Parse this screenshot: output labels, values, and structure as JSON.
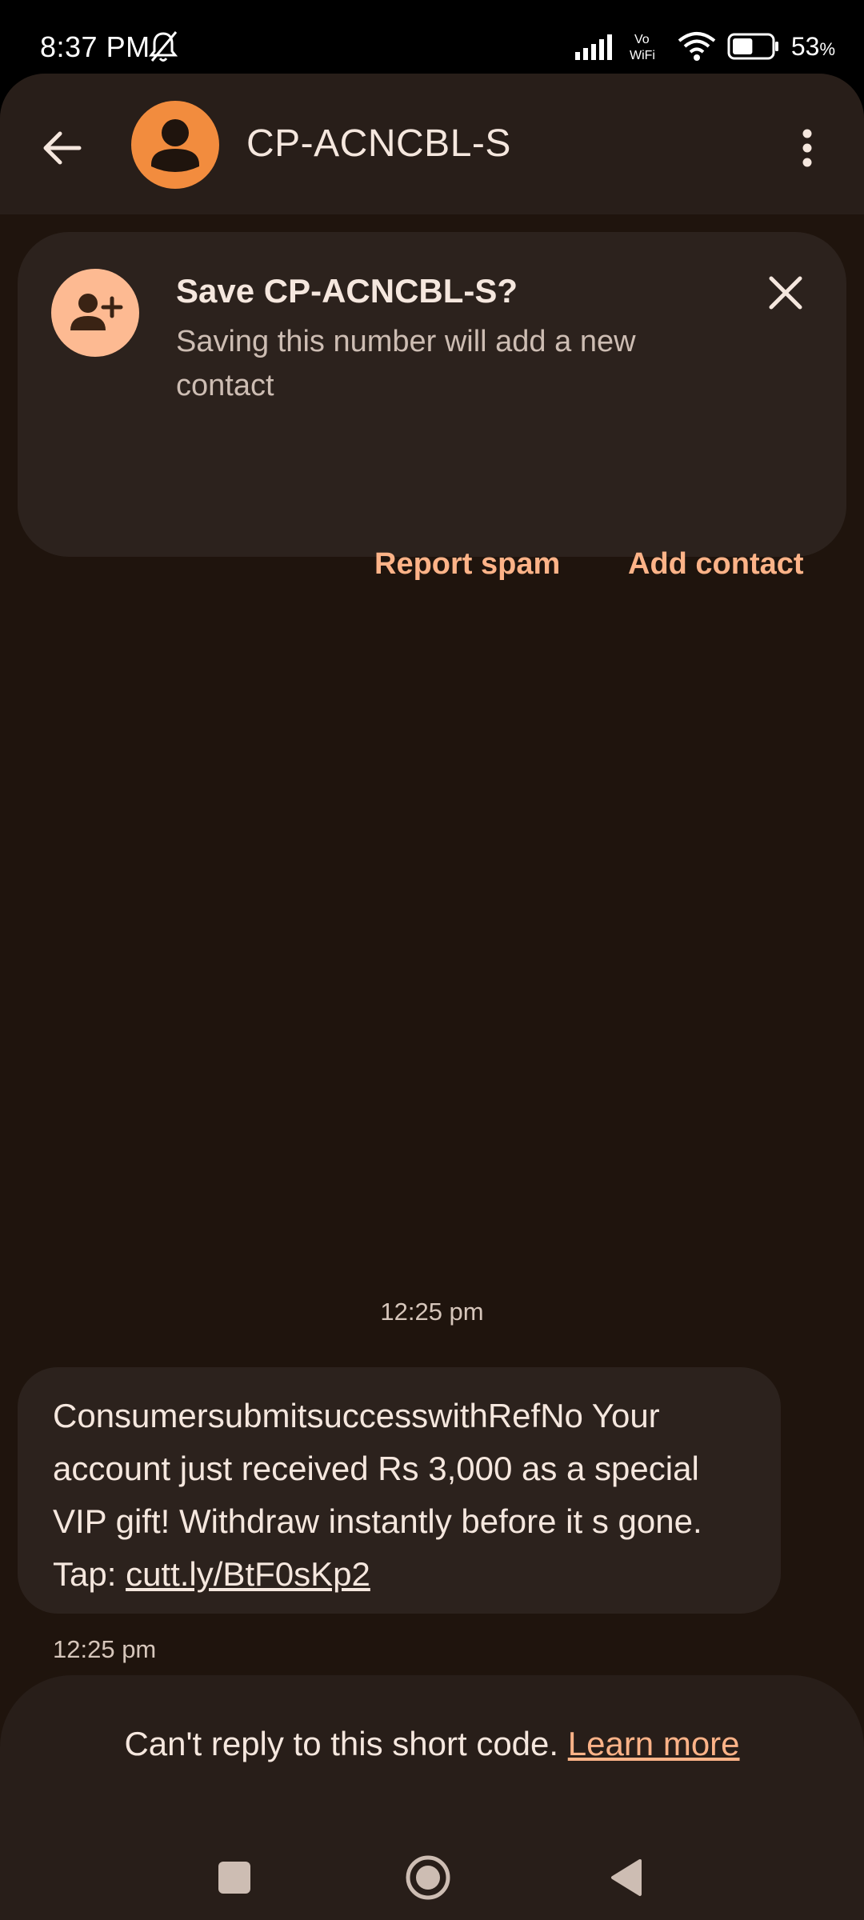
{
  "status_bar": {
    "time": "8:37 PM",
    "battery_percent": "53",
    "battery_level": 0.53,
    "network_labels": [
      "Vo",
      "WiFi"
    ]
  },
  "header": {
    "title": "CP-ACNCBL-S",
    "back_icon": "arrow-back-icon",
    "more_icon": "more-vert-icon"
  },
  "save_card": {
    "title": "Save CP-ACNCBL-S?",
    "description": "Saving this number will add a new contact",
    "report_spam_label": "Report spam",
    "add_contact_label": "Add contact"
  },
  "conversation": {
    "date_separator": "12:25 pm",
    "messages": [
      {
        "text": "ConsumersubmitsuccesswithRefNo Your account just received Rs 3,000 as a special VIP gift! Withdraw instantly before it s gone. Tap: ",
        "link": "cutt.ly/BtF0sKp2",
        "time": "12:25 pm"
      }
    ]
  },
  "footer": {
    "notice": "Can't reply to this short code.",
    "learn_more": "Learn more"
  },
  "colors": {
    "background": "#1f140d",
    "surface": "#281e19",
    "accent": "#fdb388",
    "avatar": "#f28c3e"
  }
}
